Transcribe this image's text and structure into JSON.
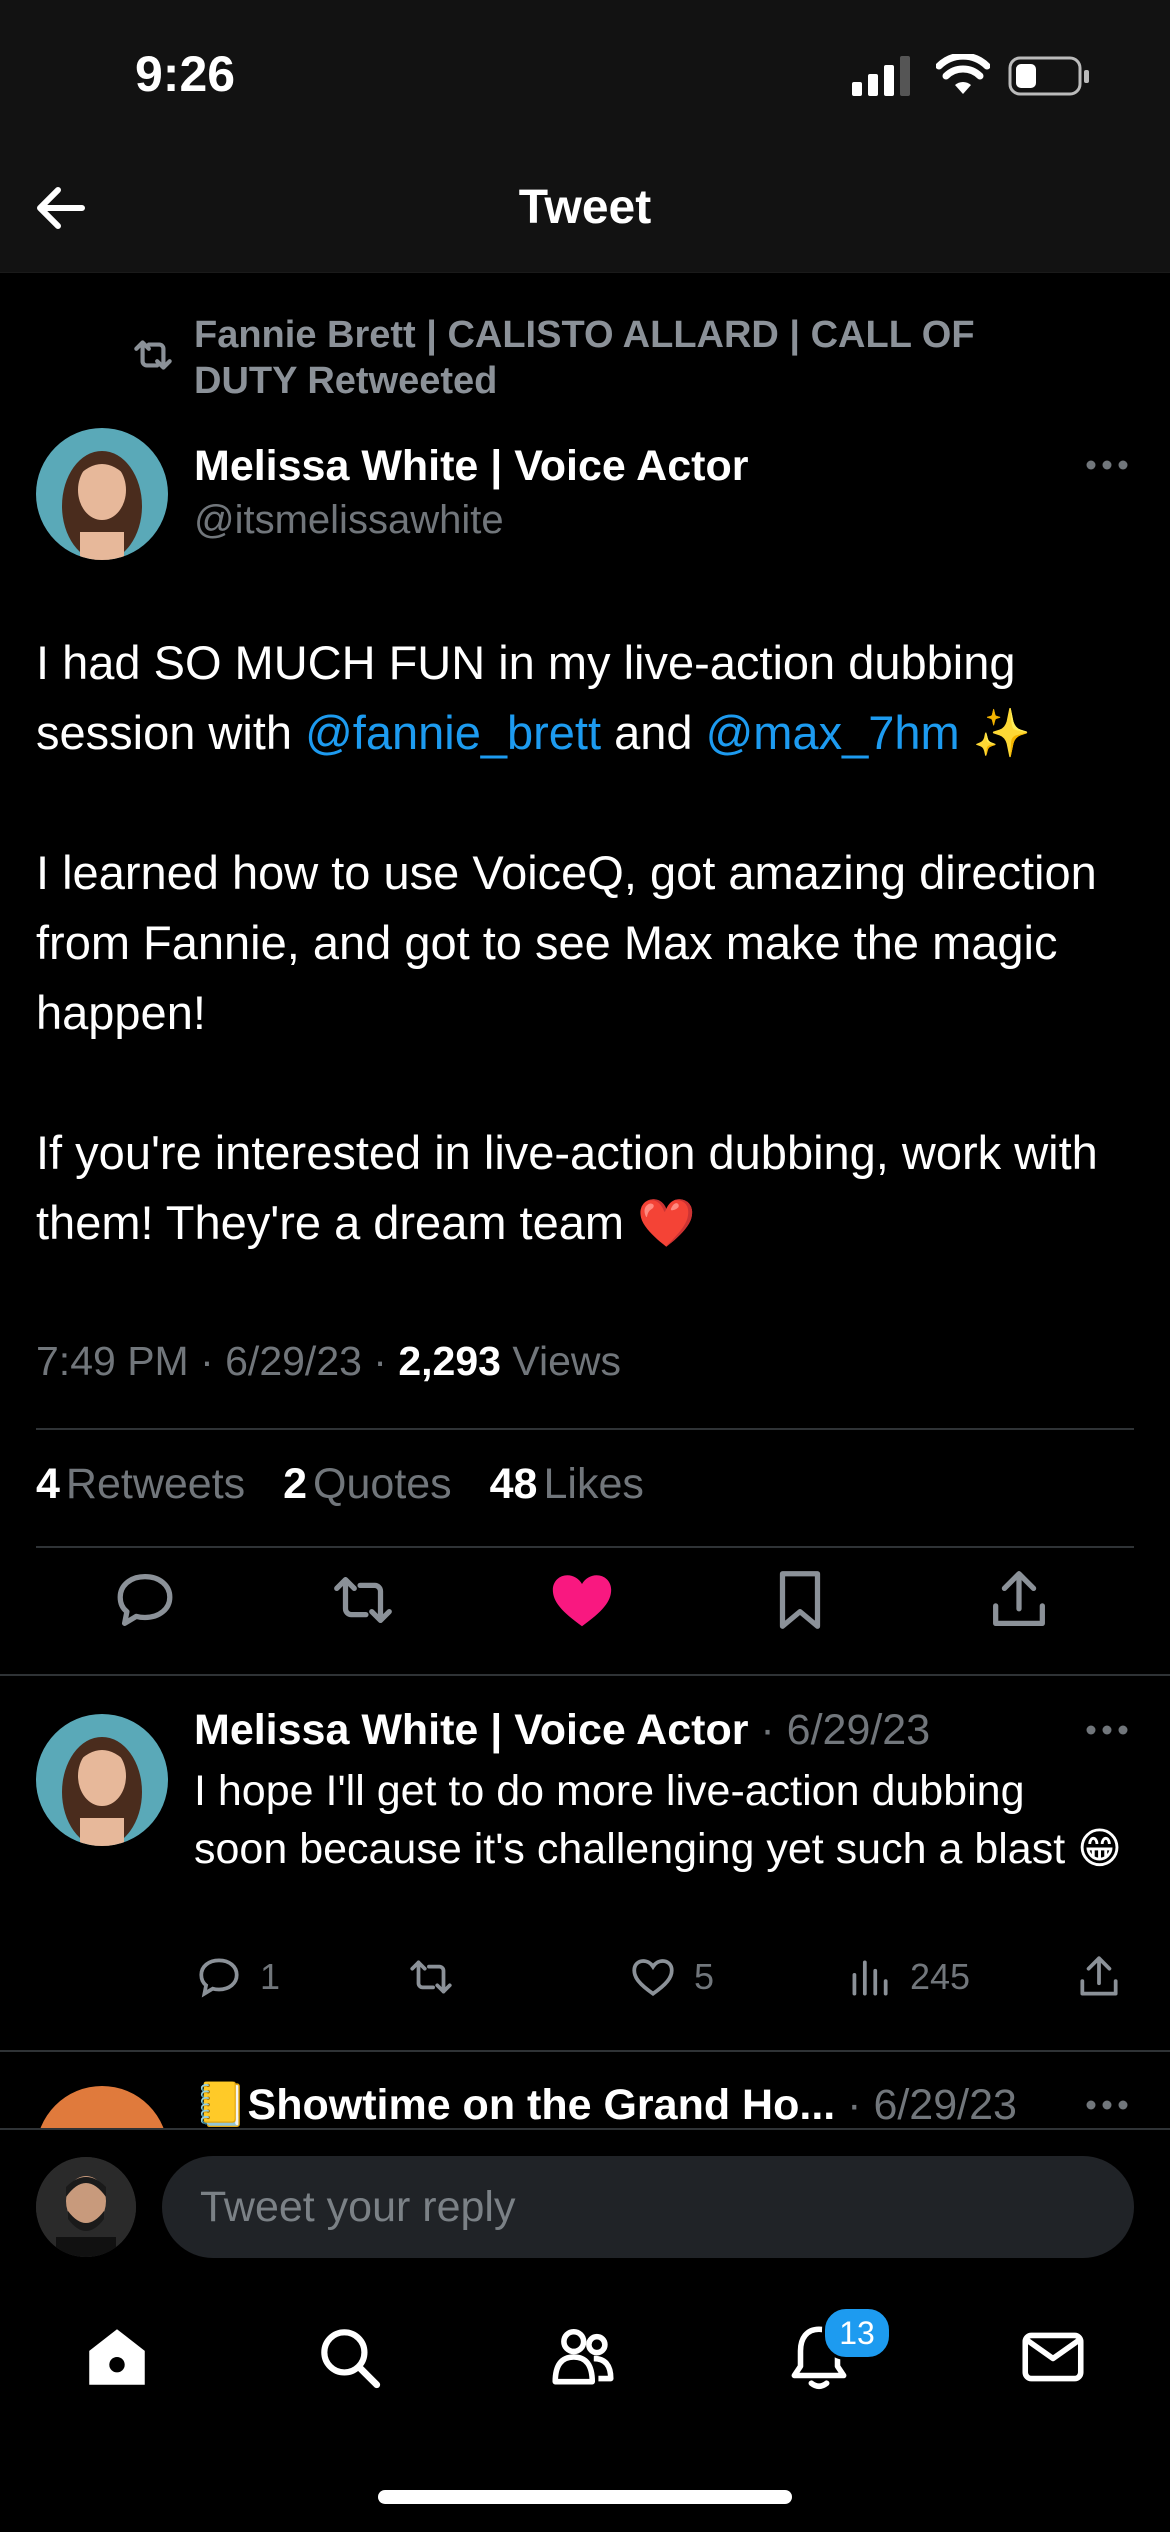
{
  "status": {
    "time": "9:26"
  },
  "header": {
    "title": "Tweet"
  },
  "tweet": {
    "retweeted_by": "Fannie Brett | CALISTO ALLARD | CALL OF DUTY Retweeted",
    "author_name": "Melissa White | Voice Actor",
    "author_handle": "@itsmelissawhite",
    "para1_a": "I had SO MUCH FUN in my live-action dubbing session with ",
    "mention1": "@fannie_brett",
    "para1_b": " and ",
    "mention2": "@max_7hm",
    "para1_emoji": " ✨",
    "para2": "I learned how to use VoiceQ, got amazing direction from Fannie, and got to see Max make the magic happen!",
    "para3": "If you're interested in live-action dubbing, work with them! They're a dream team ❤️",
    "time": "7:49 PM · 6/29/23 · ",
    "views_count": "2,293",
    "views_label": " Views",
    "retweets_count": "4",
    "retweets_label": "Retweets",
    "quotes_count": "2",
    "quotes_label": "Quotes",
    "likes_count": "48",
    "likes_label": "Likes",
    "liked": true
  },
  "reply": {
    "author_name": "Melissa White | Voice Actor",
    "date": " · 6/29/23",
    "text": "I hope I'll get to do more live-action dubbing soon because it's challenging yet such a blast 😁",
    "replies": "1",
    "likes": "5",
    "views": "245"
  },
  "next_reply": {
    "author_name": "📒Showtime on the Grand Ho...",
    "date": " · 6/29/23"
  },
  "composer": {
    "placeholder": "Tweet your reply"
  },
  "tabbar": {
    "notifications_badge": "13"
  },
  "colors": {
    "accent": "#1d9bf0",
    "like": "#f91880"
  }
}
